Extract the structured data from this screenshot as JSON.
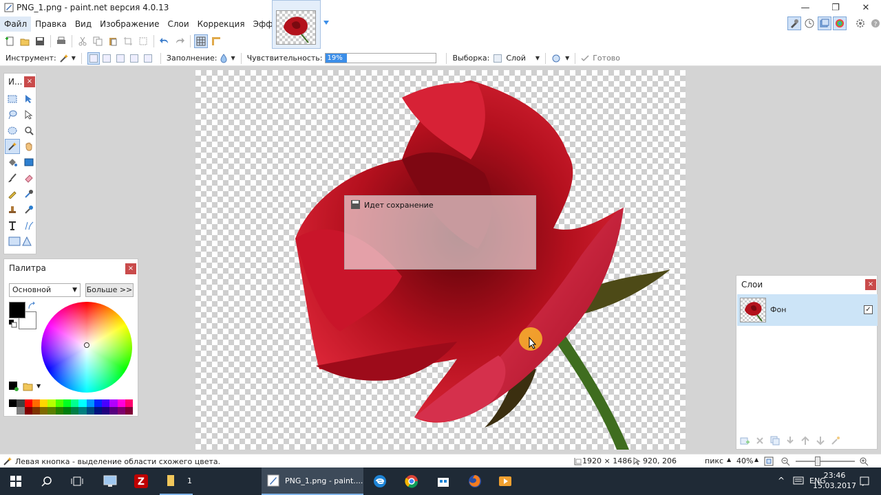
{
  "window": {
    "title": "PNG_1.png - paint.net версия 4.0.13",
    "minimize_glyph": "—",
    "restore_glyph": "❐",
    "close_glyph": "✕"
  },
  "menu": {
    "items": [
      "Файл",
      "Правка",
      "Вид",
      "Изображение",
      "Слои",
      "Коррекция",
      "Эффекты"
    ]
  },
  "toolbar2": {
    "tool_label": "Инструмент:",
    "fill_label": "Заполнение:",
    "sensitivity_label": "Чувствительность:",
    "sensitivity_value": "19%",
    "sensitivity_fraction": 0.19,
    "selection_label": "Выборка:",
    "layer_option": "Слой",
    "done_label": "Готово"
  },
  "tools_panel": {
    "title": "И...",
    "close": "×"
  },
  "save_dialog": {
    "title": "Идет сохранение"
  },
  "palette_panel": {
    "title": "Палитра",
    "close": "×",
    "mode_value": "Основной",
    "more_button": "Больше >>"
  },
  "layers_panel": {
    "title": "Слои",
    "close": "×",
    "layer_name": "Фон",
    "layer_visible_glyph": "✓"
  },
  "statusbar": {
    "hint": "Левая кнопка - выделение области схожего цвета.",
    "image_size": "1920 × 1486",
    "cursor_pos": "920, 206",
    "unit": "пикс",
    "zoom": "40%"
  },
  "taskbar": {
    "explorer_count": "1",
    "active_task_label": "PNG_1.png - paint....",
    "lang": "ENG",
    "time": "23:46",
    "date": "15.03.2017"
  },
  "colors": {
    "accent": "#3c8ee8",
    "selection_bg": "#cce4f7",
    "panel_close": "#c94b4b",
    "taskbar": "#1f2a36"
  },
  "palette_swatches": [
    "#000000",
    "#404040",
    "#ff0000",
    "#ff6a00",
    "#ffd800",
    "#b6ff00",
    "#4cff00",
    "#00ff21",
    "#00ff90",
    "#00ffff",
    "#0094ff",
    "#0026ff",
    "#4800ff",
    "#b200ff",
    "#ff00dc",
    "#ff006e",
    "#ffffff",
    "#808080",
    "#7f0000",
    "#7f3300",
    "#7f6a00",
    "#5b7f00",
    "#267f00",
    "#007f0e",
    "#007f46",
    "#007f7f",
    "#004a7f",
    "#00137f",
    "#21007f",
    "#57007f",
    "#7f006e",
    "#7f0037"
  ]
}
